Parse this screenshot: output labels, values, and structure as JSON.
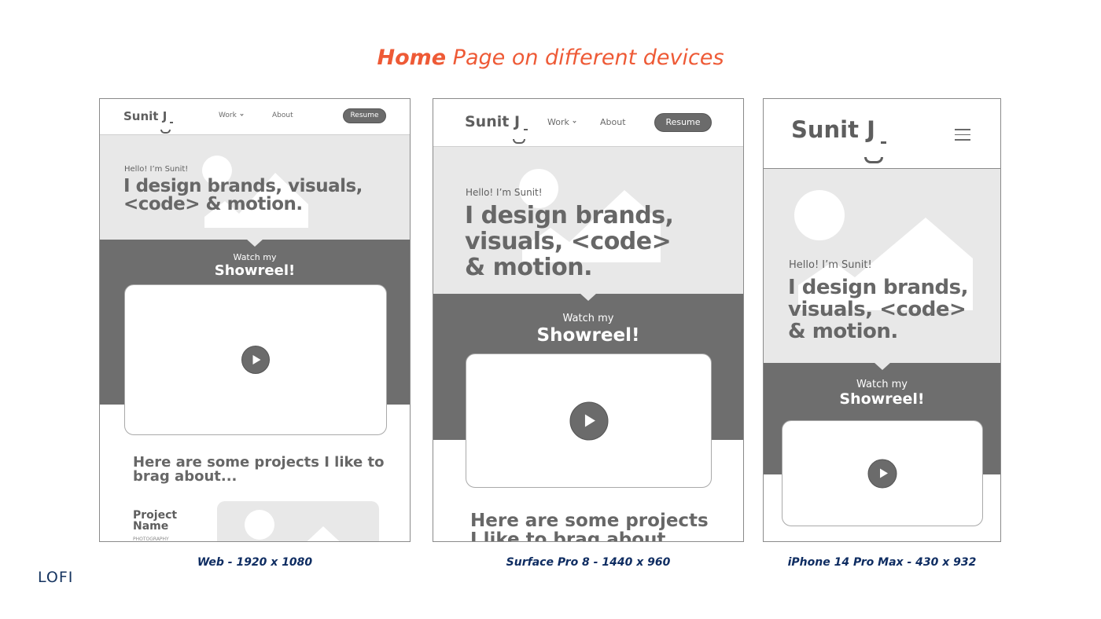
{
  "title": {
    "bold": "Home",
    "rest": "Page on different devices",
    "color": "#ee5a36"
  },
  "label": "LOFI",
  "devices": [
    {
      "caption": "Web - 1920 x 1080",
      "logo": "Sunit J",
      "nav": {
        "work": "Work",
        "about": "About",
        "resume": "Resume"
      },
      "hero": {
        "hello": "Hello! I’m Sunit!",
        "headline_lines": [
          "I design brands, visuals,",
          "<code> & motion."
        ]
      },
      "showreel": {
        "watch": "Watch my",
        "title": "Showreel!"
      },
      "projects": {
        "title_lines": [
          "Here are some projects I like to",
          "brag about..."
        ],
        "project_name_lines": [
          "Project",
          "Name"
        ],
        "project_category": "PHOTOGRAPHY"
      }
    },
    {
      "caption": "Surface Pro 8 - 1440 x 960",
      "logo": "Sunit J",
      "nav": {
        "work": "Work",
        "about": "About",
        "resume": "Resume"
      },
      "hero": {
        "hello": "Hello! I’m Sunit!",
        "headline_lines": [
          "I design brands,",
          "visuals, <code>",
          "& motion."
        ]
      },
      "showreel": {
        "watch": "Watch my",
        "title": "Showreel!"
      },
      "projects": {
        "title_lines": [
          "Here are some projects",
          "I like to brag about..."
        ]
      }
    },
    {
      "caption": "iPhone 14 Pro Max - 430 x 932",
      "logo": "Sunit J",
      "nav": {
        "menu_icon": "hamburger-menu-icon"
      },
      "hero": {
        "hello": "Hello! I’m Sunit!",
        "headline_lines": [
          "I design brands,",
          "visuals, <code>",
          "& motion."
        ]
      },
      "showreel": {
        "watch": "Watch my",
        "title": "Showreel!"
      }
    }
  ],
  "colors": {
    "caption": "#0f2d62",
    "wire_dark": "#6e6e6e",
    "wire_light": "#e8e8e8"
  }
}
